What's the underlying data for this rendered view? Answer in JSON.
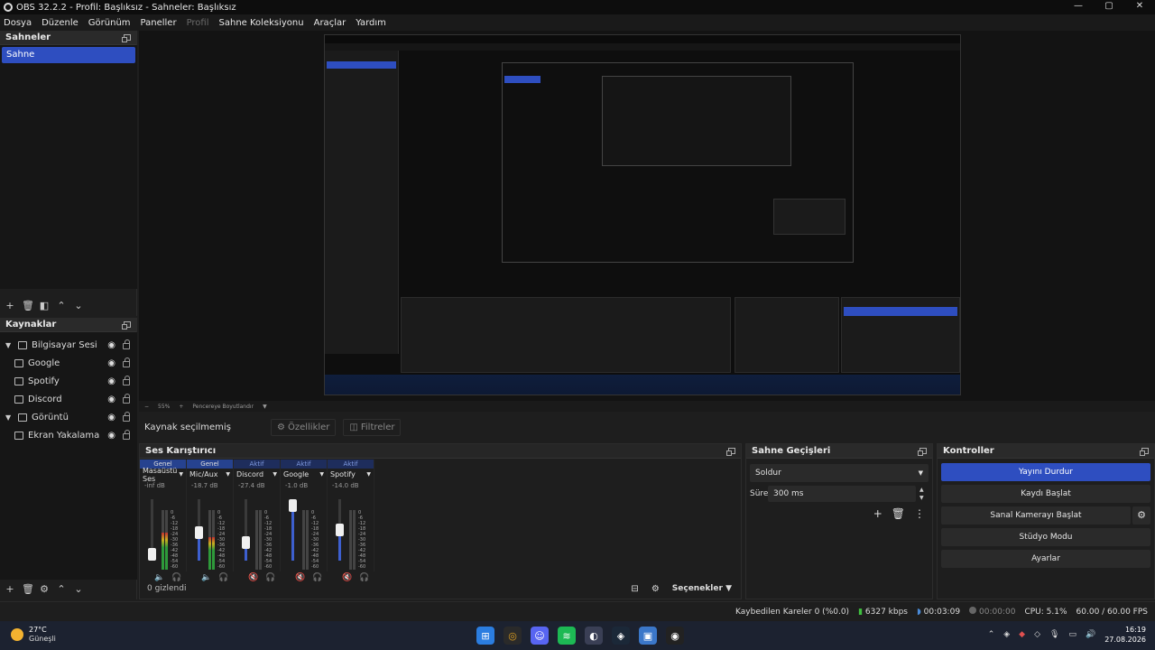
{
  "window": {
    "title": "OBS 32.2.2 - Profil: Başlıksız - Sahneler: Başlıksız",
    "controls": [
      "—",
      "▢",
      "✕"
    ]
  },
  "menu": [
    "Dosya",
    "Düzenle",
    "Görünüm",
    "Paneller",
    "Profil",
    "Sahne Koleksiyonu",
    "Araçlar",
    "Yardım"
  ],
  "scenes": {
    "title": "Sahneler",
    "items": [
      "Sahne"
    ]
  },
  "sources": {
    "title": "Kaynaklar",
    "items": [
      {
        "label": "Bilgisayar Sesi",
        "type": "group",
        "child": false
      },
      {
        "label": "Google",
        "type": "window",
        "child": true
      },
      {
        "label": "Spotify",
        "type": "window",
        "child": true
      },
      {
        "label": "Discord",
        "type": "window",
        "child": true
      },
      {
        "label": "Görüntü",
        "type": "group",
        "child": false
      },
      {
        "label": "Ekran Yakalama",
        "type": "display",
        "child": true
      }
    ]
  },
  "preview": {
    "zoom": "55%",
    "fit_label": "Pencereye Boyutlandır"
  },
  "context": {
    "no_selection": "Kaynak seçilmemiş",
    "properties": "Özellikler",
    "filters": "Filtreler"
  },
  "mixer": {
    "title": "Ses Karıştırıcı",
    "hidden_label": "0 gizlendi",
    "options_label": "Seçenekler",
    "channels": [
      {
        "status": "Genel",
        "name": "Masaüstü Ses",
        "db": "-inf dB",
        "volume": 0.05,
        "meter": 0.62,
        "muted": false,
        "status_type": "genel"
      },
      {
        "status": "Genel",
        "name": "Mic/Aux",
        "db": "-18.7 dB",
        "volume": 0.45,
        "meter": 0.55,
        "muted": false,
        "status_type": "genel"
      },
      {
        "status": "Aktif",
        "name": "Discord",
        "db": "-27.4 dB",
        "volume": 0.3,
        "meter": 0.0,
        "muted": true,
        "status_type": "aktif"
      },
      {
        "status": "Aktif",
        "name": "Google",
        "db": "-1.0 dB",
        "volume": 0.9,
        "meter": 0.0,
        "muted": true,
        "status_type": "aktif"
      },
      {
        "status": "Aktif",
        "name": "Spotify",
        "db": "-14.0 dB",
        "volume": 0.5,
        "meter": 0.0,
        "muted": true,
        "status_type": "aktif"
      }
    ],
    "ticks": [
      "0",
      "-6",
      "-12",
      "-18",
      "-24",
      "-30",
      "-36",
      "-42",
      "-48",
      "-54",
      "-60"
    ]
  },
  "transitions": {
    "title": "Sahne Geçişleri",
    "selected": "Soldur",
    "duration_label": "Süre",
    "duration_value": "300 ms"
  },
  "controls": {
    "title": "Kontroller",
    "stop_stream": "Yayını Durdur",
    "start_record": "Kaydı Başlat",
    "start_virtualcam": "Sanal Kamerayı Başlat",
    "studio_mode": "Stüdyo Modu",
    "settings": "Ayarlar"
  },
  "status": {
    "dropped": "Kaybedilen Kareler 0 (%0.0)",
    "bitrate": "6327 kbps",
    "stream_time": "00:03:09",
    "rec_time": "00:00:00",
    "cpu": "CPU: 5.1%",
    "fps": "60.00 / 60.00 FPS"
  },
  "taskbar": {
    "temperature": "27°C",
    "condition": "Güneşli",
    "time": "16:19",
    "date": "27.08.2026"
  },
  "colors": {
    "accent": "#2e4ec0",
    "panel_bg": "#1e1e1e",
    "mute_red": "#d94040",
    "meter_green": "#2e9a3a"
  }
}
